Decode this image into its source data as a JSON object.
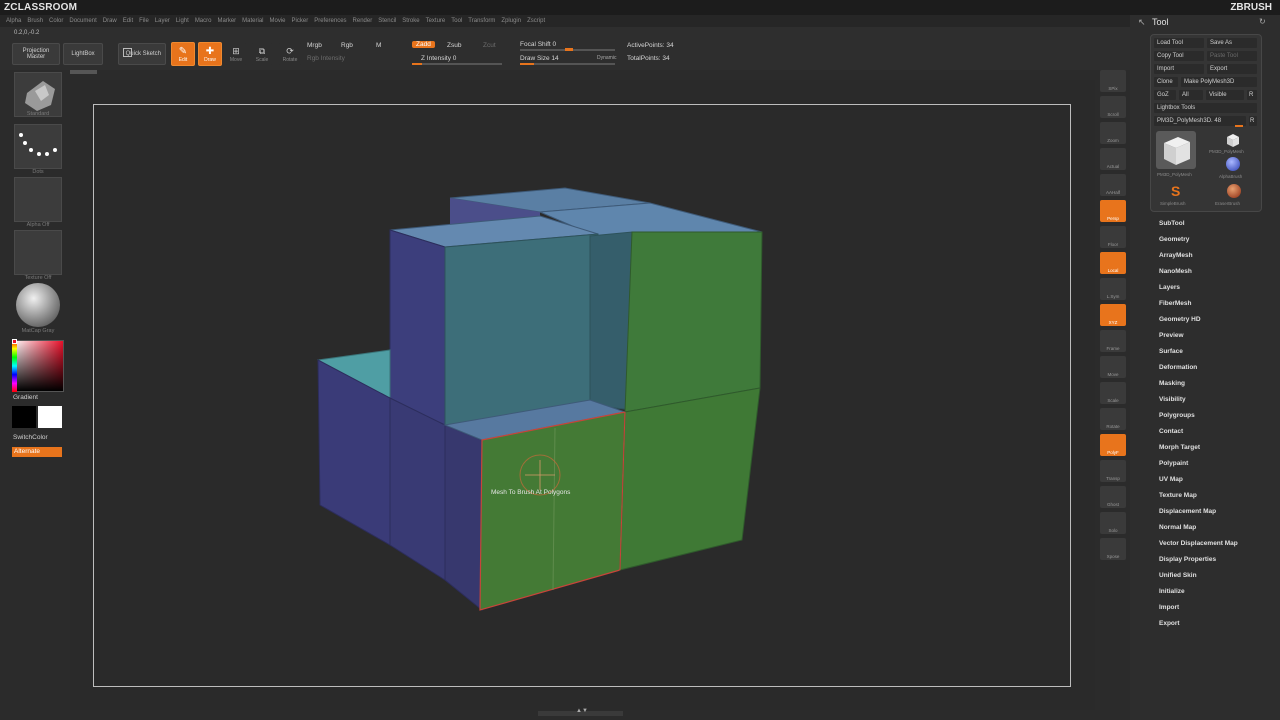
{
  "app": {
    "brand_left": "ZCLASSROOM",
    "brand_right": "ZBRUSH"
  },
  "menu": [
    "Alpha",
    "Brush",
    "Color",
    "Document",
    "Draw",
    "Edit",
    "File",
    "Layer",
    "Light",
    "Macro",
    "Marker",
    "Material",
    "Movie",
    "Picker",
    "Preferences",
    "Render",
    "Stencil",
    "Stroke",
    "Texture",
    "Tool",
    "Transform",
    "Zplugin",
    "Zscript"
  ],
  "coords": "0.2,0,-0.2",
  "shelf": {
    "projection_master": "Projection Master",
    "lightbox": "LightBox",
    "quick_sketch": "Quick Sketch",
    "edit": "Edit",
    "draw": "Draw",
    "move": "Move",
    "scale": "Scale",
    "rotate": "Rotate",
    "mrgb": "Mrgb",
    "rgb": "Rgb",
    "m": "M",
    "zadd": "Zadd",
    "zsub": "Zsub",
    "zcut": "Zcut",
    "rgb_intensity": "Rgb Intensity",
    "z_intensity": "Z Intensity 0",
    "focal_shift": "Focal Shift 0",
    "draw_size": "Draw Size 14",
    "dynamic": "Dynamic",
    "active_points": "ActivePoints: 34",
    "total_points": "TotalPoints: 34"
  },
  "left": {
    "brush_cap": "Standard",
    "stroke_cap": "Dots",
    "alpha_cap": "Alpha Off",
    "texture_cap": "Texture Off",
    "material_cap": "MatCap Gray",
    "gradient": "Gradient",
    "switch_color": "SwitchColor",
    "alternate": "Alternate"
  },
  "viewport": {
    "tooltip": "Mesh To Brush At Polygons"
  },
  "right_shelf": [
    "SPix",
    "Scroll",
    "Zoom",
    "Actual",
    "AAHalf",
    "Persp",
    "Floor",
    "Local",
    "L.Sym",
    "XYZ",
    "Frame",
    "Move",
    "Scale",
    "Rotate",
    "PolyF",
    "Transp",
    "Ghost",
    "Solo",
    "Xpose"
  ],
  "tool": {
    "header": "Tool",
    "load_tool": "Load Tool",
    "save_as": "Save As",
    "copy_tool": "Copy Tool",
    "paste_tool": "Paste Tool",
    "import": "Import",
    "export": "Export",
    "clone": "Clone",
    "make_polymesh": "Make PolyMesh3D",
    "goz": "GoZ",
    "all": "All",
    "visible": "Visible",
    "r": "R",
    "lightbox_tools": "Lightbox Tools",
    "current_tool": "PM3D_PolyMesh3D. 48",
    "thumb1": "PM3D_PolyMesh",
    "thumb2": "PM3D_PolyMesh",
    "alpha_brush": "AlphaBrush",
    "simple_brush": "SimpleBrush",
    "eraser_brush": "EraserBrush",
    "items": [
      "SubTool",
      "Geometry",
      "ArrayMesh",
      "NanoMesh",
      "Layers",
      "FiberMesh",
      "Geometry HD",
      "Preview",
      "Surface",
      "Deformation",
      "Masking",
      "Visibility",
      "Polygroups",
      "Contact",
      "Morph Target",
      "Polypaint",
      "UV Map",
      "Texture Map",
      "Displacement Map",
      "Normal Map",
      "Vector Displacement Map",
      "Display Properties",
      "Unified Skin",
      "Initialize",
      "Import",
      "Export"
    ]
  }
}
